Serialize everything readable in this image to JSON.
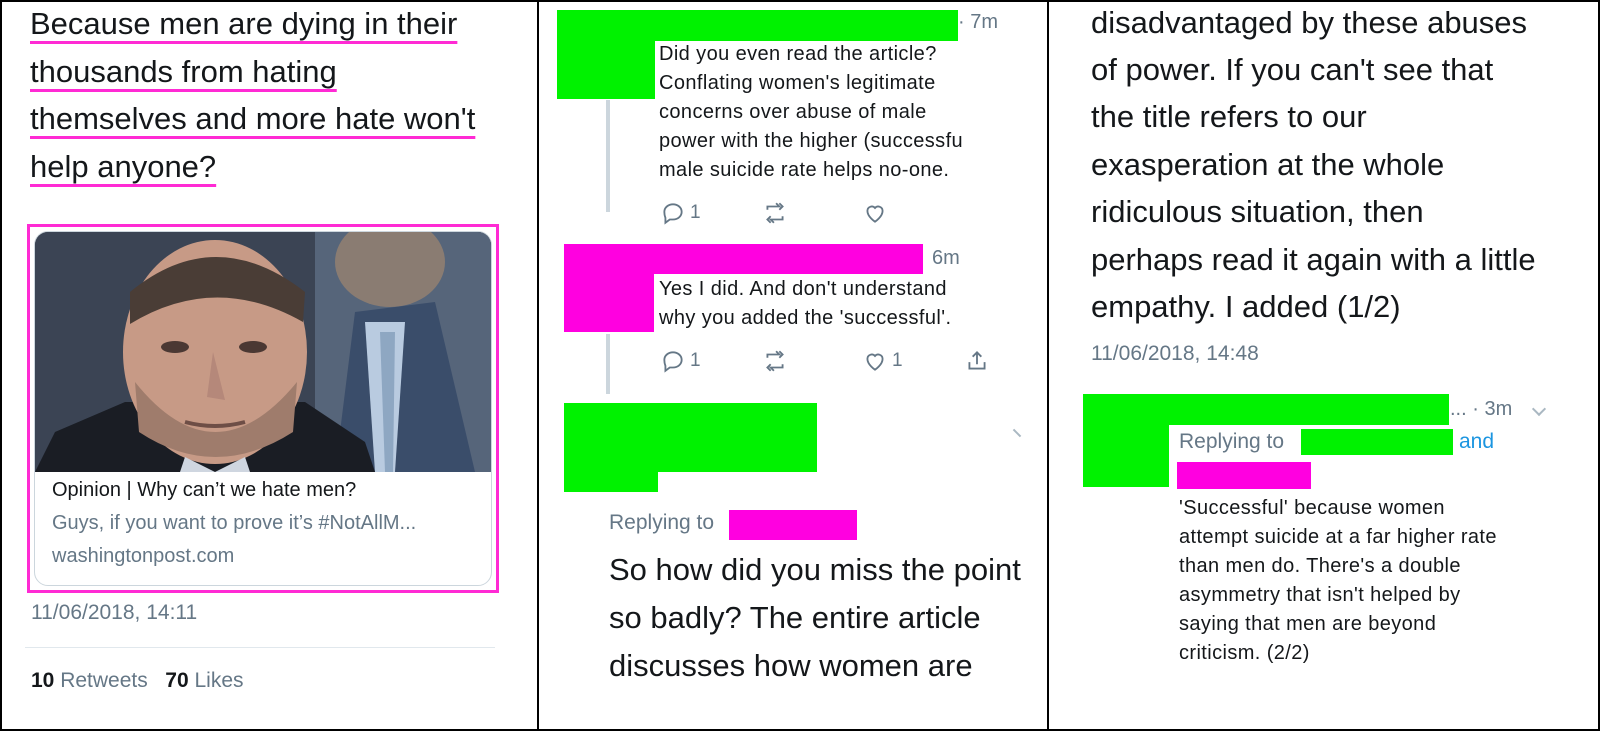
{
  "panel1": {
    "tweet_lines": [
      "Because men are dying in their",
      "thousands from hating",
      "themselves and more hate won't",
      "help anyone?"
    ],
    "card": {
      "title": "Opinion | Why can’t we hate men?",
      "description": "Guys, if you want to prove it’s #NotAllM...",
      "domain": "washingtonpost.com"
    },
    "timestamp": "11/06/2018, 14:11",
    "retweets_count": "10",
    "retweets_label": "Retweets",
    "likes_count": "70",
    "likes_label": "Likes"
  },
  "panel2": {
    "reply1": {
      "time": "· 7m",
      "lines": [
        "Did you even read the article?",
        "Conflating women's legitimate",
        "concerns over abuse of male",
        "power with the higher (successfu",
        "male suicide rate helps no-one."
      ],
      "reply_count": "1"
    },
    "reply2": {
      "time": "6m",
      "lines": [
        "Yes I did. And don't understand",
        "why you added the 'successful'."
      ],
      "reply_count": "1",
      "like_count": "1"
    },
    "main": {
      "replying_label": "Replying to",
      "lines": [
        "So how did you miss the point",
        "so badly? The entire article",
        "discusses how women are"
      ]
    }
  },
  "panel3": {
    "lines": [
      "disadvantaged by these abuses",
      "of power. If you can't see that",
      "the title refers to our",
      "exasperation at the whole",
      "ridiculous situation, then",
      "perhaps read it again with a little",
      "empathy. I added (1/2)"
    ],
    "timestamp": "11/06/2018, 14:48",
    "reply": {
      "time": "... · 3m",
      "replying_label": "Replying to",
      "and_label": "and",
      "lines": [
        "'Successful' because women",
        "attempt suicide at a far higher rate",
        "than men do. There's a double",
        "asymmetry that isn't helped by",
        "saying that men are beyond",
        "criticism. (2/2)"
      ]
    }
  },
  "colors": {
    "redact_green": "#00f200",
    "redact_pink": "#ff00e0",
    "underline_pink": "#ff2ad4",
    "twitter_grey": "#657786",
    "twitter_blue": "#1b95e0"
  }
}
